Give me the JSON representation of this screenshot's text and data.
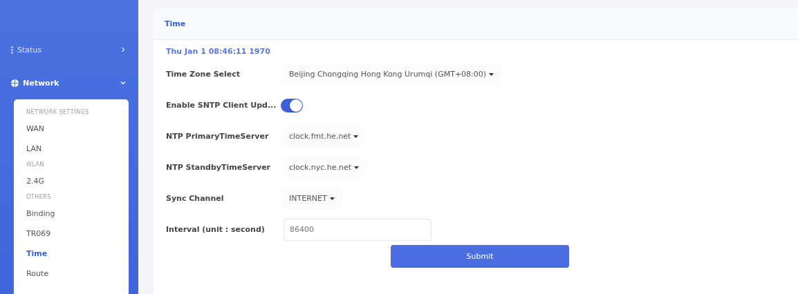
{
  "sidebar": {
    "menus": [
      {
        "label": "Status",
        "expanded": false
      },
      {
        "label": "Network",
        "expanded": true
      }
    ],
    "submenu": [
      {
        "kind": "heading",
        "label": "NETWORK SETTINGS"
      },
      {
        "kind": "item",
        "label": "WAN",
        "selected": false
      },
      {
        "kind": "item",
        "label": "LAN",
        "selected": false
      },
      {
        "kind": "heading",
        "label": "WLAN"
      },
      {
        "kind": "item",
        "label": "2.4G",
        "selected": false
      },
      {
        "kind": "heading",
        "label": "OTHERS"
      },
      {
        "kind": "item",
        "label": "Binding",
        "selected": false
      },
      {
        "kind": "item",
        "label": "TR069",
        "selected": false
      },
      {
        "kind": "item",
        "label": "Time",
        "selected": true
      },
      {
        "kind": "item",
        "label": "Route",
        "selected": false
      }
    ]
  },
  "panel": {
    "title": "Time",
    "current_time": "Thu Jan 1 08:46:11 1970",
    "fields": [
      {
        "kind": "select",
        "label": "Time Zone Select",
        "value": "Beijing Chongqing Hong Kong Urumqi (GMT+08:00)"
      },
      {
        "kind": "toggle",
        "label": "Enable SNTP Client Upd...",
        "on": true
      },
      {
        "kind": "select",
        "label": "NTP PrimaryTimeServer",
        "value": "clock.fmt.he.net"
      },
      {
        "kind": "select",
        "label": "NTP StandbyTimeServer",
        "value": "clock.nyc.he.net"
      },
      {
        "kind": "select",
        "label": "Sync Channel",
        "value": "INTERNET"
      },
      {
        "kind": "input",
        "label": "Interval (unit : second)",
        "placeholder": "86400"
      }
    ],
    "submit": "Submit"
  }
}
